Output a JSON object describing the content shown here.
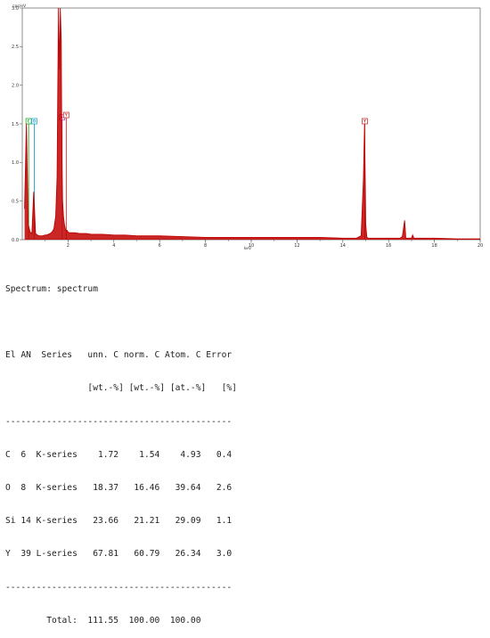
{
  "chart_data": {
    "type": "line",
    "title": "",
    "ylabel": "cps/eV",
    "xlabel": "keV",
    "xlim": [
      0,
      20
    ],
    "ylim": [
      0,
      3.0
    ],
    "x_ticks": [
      "2",
      "4",
      "6",
      "8",
      "10",
      "12",
      "14",
      "16",
      "18",
      "20"
    ],
    "y_ticks": [
      "0.0",
      "0.5",
      "1.0",
      "1.5",
      "2.0",
      "2.5",
      "3.0"
    ],
    "grid": false,
    "line_color": "#c00000",
    "series": [
      {
        "x": [
          0.1,
          0.18,
          0.26,
          0.34,
          0.42,
          0.5,
          0.58,
          0.66,
          0.74,
          0.82,
          0.9,
          0.98,
          1.06,
          1.14,
          1.22,
          1.3,
          1.38,
          1.46,
          1.52,
          1.58,
          1.62,
          1.66,
          1.7,
          1.72,
          1.74,
          1.76,
          1.8,
          1.84,
          1.88,
          1.92,
          1.96,
          2.0,
          2.05,
          2.1,
          2.2,
          2.3,
          2.5,
          2.8,
          3.0,
          3.5,
          4.0,
          4.5,
          5.0,
          6.0,
          7.0,
          8.0,
          9.0,
          10.0,
          11.0,
          12.0,
          13.0,
          14.0,
          14.6,
          14.8,
          14.9,
          14.95,
          15.0,
          15.05,
          15.1,
          15.2,
          15.5,
          16.0,
          16.5,
          16.6,
          16.7,
          16.75,
          16.8,
          16.9,
          17.0,
          17.05,
          17.1,
          17.2,
          17.5,
          18.0,
          19.0,
          20.0
        ],
        "y": [
          0.4,
          1.5,
          0.2,
          0.1,
          0.08,
          0.62,
          0.08,
          0.06,
          0.05,
          0.05,
          0.05,
          0.06,
          0.06,
          0.07,
          0.08,
          0.1,
          0.14,
          0.3,
          0.8,
          3.0,
          2.2,
          3.0,
          2.6,
          1.6,
          0.9,
          0.5,
          0.3,
          0.2,
          0.14,
          0.12,
          0.12,
          0.1,
          0.09,
          0.09,
          0.09,
          0.09,
          0.08,
          0.08,
          0.07,
          0.07,
          0.06,
          0.06,
          0.05,
          0.05,
          0.04,
          0.03,
          0.03,
          0.03,
          0.03,
          0.03,
          0.03,
          0.02,
          0.02,
          0.05,
          0.78,
          1.5,
          0.2,
          0.03,
          0.02,
          0.02,
          0.02,
          0.02,
          0.02,
          0.04,
          0.25,
          0.02,
          0.02,
          0.02,
          0.02,
          0.06,
          0.02,
          0.02,
          0.02,
          0.02,
          0.01,
          0.01
        ]
      }
    ],
    "element_markers": [
      {
        "label": "C",
        "x": 0.277,
        "height": 1.5,
        "color": "#22aa22"
      },
      {
        "label": "O",
        "x": 0.525,
        "height": 1.5,
        "color": "#1aa7c9"
      },
      {
        "label": "Si",
        "x": 1.74,
        "height": 1.55,
        "color": "#cc44aa"
      },
      {
        "label": "Y",
        "x": 1.92,
        "height": 1.58,
        "color": "#cc3333"
      },
      {
        "label": "Y",
        "x": 14.96,
        "height": 1.5,
        "color": "#cc3333"
      }
    ]
  },
  "report": {
    "spectrum_line": "Spectrum: spectrum",
    "header1": "El AN  Series   unn. C norm. C Atom. C Error",
    "header2": "                [wt.-%] [wt.-%] [at.-%]   [%]",
    "divider": "--------------------------------------------",
    "rows": [
      "C  6  K-series    1.72    1.54    4.93   0.4",
      "O  8  K-series   18.37   16.46   39.64   2.6",
      "Si 14 K-series   23.66   21.21   29.09   1.1",
      "Y  39 L-series   67.81   60.79   26.34   3.0"
    ],
    "total": "        Total:  111.55  100.00  100.00"
  }
}
